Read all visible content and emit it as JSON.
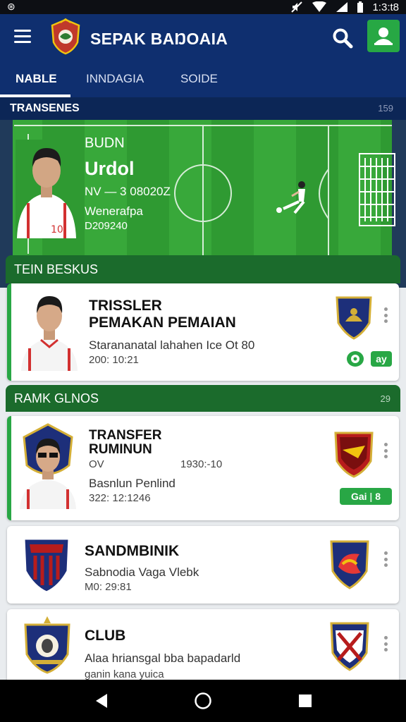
{
  "status_bar": {
    "left_icon": "app-notification-icon",
    "time": "1:3:t8",
    "icons": [
      "mute-icon",
      "wifi-icon",
      "signal-icon",
      "battery-icon"
    ]
  },
  "app_bar": {
    "title": "SEPAK BAŊOAIA",
    "menu_icon": "hamburger-menu-icon",
    "logo_icon": "crest-logo-icon",
    "search_icon": "search-icon",
    "account_icon": "account-icon",
    "accent": "#27a844",
    "bg": "#0f2f6f"
  },
  "tabs": [
    {
      "label": "NABLE",
      "active": true
    },
    {
      "label": "INNDAGIA",
      "active": false
    },
    {
      "label": "SOIDE",
      "active": false
    }
  ],
  "section_transfers": {
    "title": "TRANSENES",
    "count": "159"
  },
  "hero": {
    "name": "BUDN",
    "title": "Urdol",
    "line1": "NV — 3 08020Z",
    "line2": "Wenerafpa",
    "line3": "D209240"
  },
  "section_team": {
    "title": "TEIN BESKUS"
  },
  "card1": {
    "title_line1": "TRISSLER",
    "title_line2": "PEMAKAN PEMAIAN",
    "sub": "Starananatal lahahen Ice Ot 80",
    "date": "200: 10:21",
    "badge_icon": "soccer-ball-icon",
    "badge_label": "ay"
  },
  "section_rank": {
    "title": "RAMK GLNOS",
    "count": "29"
  },
  "card2": {
    "title_line1": "TRANSFER",
    "title_line2": "RUMINUN",
    "meta_left": "OV",
    "meta_right": "1930:-10",
    "sub": "Basnlun Penlind",
    "date": "322: 12:1246",
    "pill_left": "Gai",
    "pill_right": "8"
  },
  "card3": {
    "title": "SANDMBINIK",
    "sub": "Sabnodia Vaga Vlebk",
    "date": "M0: 29:81"
  },
  "card4": {
    "title": "CLUB",
    "sub": "Alaa hriansgal bba bapadarld",
    "extra": "ganin kana yuica"
  },
  "nav_bar": {
    "icons": [
      "back-icon",
      "home-icon",
      "recents-icon"
    ]
  },
  "colors": {
    "green": "#28a745",
    "dark_green": "#1b6b2c",
    "navy": "#0f2f6f",
    "pitch": "#2f9a32"
  }
}
